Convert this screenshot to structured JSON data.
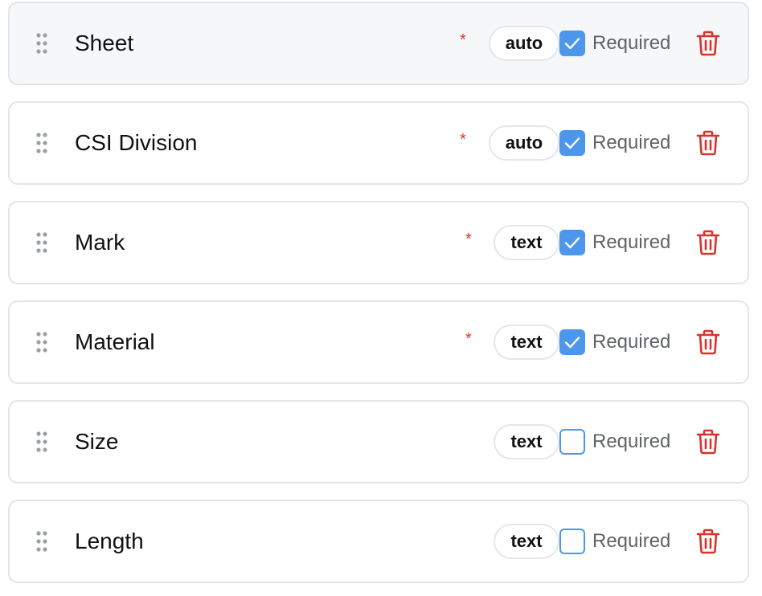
{
  "fields": [
    {
      "name": "Sheet",
      "type": "auto",
      "required": true,
      "required_label": "Required",
      "required_marker": "*"
    },
    {
      "name": "CSI Division",
      "type": "auto",
      "required": true,
      "required_label": "Required",
      "required_marker": "*"
    },
    {
      "name": "Mark",
      "type": "text",
      "required": true,
      "required_label": "Required",
      "required_marker": "*"
    },
    {
      "name": "Material",
      "type": "text",
      "required": true,
      "required_label": "Required",
      "required_marker": "*"
    },
    {
      "name": "Size",
      "type": "text",
      "required": false,
      "required_label": "Required"
    },
    {
      "name": "Length",
      "type": "text",
      "required": false,
      "required_label": "Required"
    }
  ],
  "icons": {
    "drag": "drag-handle-icon",
    "check": "check-icon",
    "delete": "trash-icon"
  },
  "colors": {
    "accent": "#4c97eb",
    "danger": "#d9342b",
    "asterisk": "#e0362b",
    "muted_text": "#5f6368",
    "border": "#e3e5e9",
    "drag_dots": "#9aa0a6"
  }
}
